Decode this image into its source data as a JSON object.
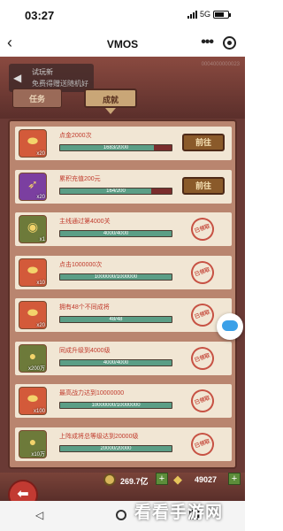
{
  "status": {
    "time": "03:27",
    "network": "5G"
  },
  "nav": {
    "title": "VMOS"
  },
  "game": {
    "ad_line1": "试玩新",
    "ad_line2": "免费得赠送随机好礼",
    "corner_text": "0004000000023",
    "tabs": [
      {
        "label": "任务"
      },
      {
        "label": "成就"
      }
    ],
    "active_tab": "成就",
    "go_label": "前往",
    "claimed_label": "已领取",
    "achievements": [
      {
        "title": "点金2000次",
        "progress_text": "1683/2000",
        "progress": 0.84,
        "reward_count": "x20",
        "icon": "gold-ingot-icon",
        "icon_color": "#d35a3a",
        "action": "go"
      },
      {
        "title": "累积充值200元",
        "progress_text": "164/200",
        "progress": 0.82,
        "reward_count": "x20",
        "icon": "feather-icon",
        "icon_color": "#7b3fa0",
        "action": "go"
      },
      {
        "title": "主线通过第4000关",
        "progress_text": "4000/4000",
        "progress": 1.0,
        "reward_count": "x1",
        "icon": "drum-icon",
        "icon_color": "#6d7a3a",
        "action": "claimed"
      },
      {
        "title": "点击1000000次",
        "progress_text": "1000000/1000000",
        "progress": 1.0,
        "reward_count": "x10",
        "icon": "gold-ingot-icon",
        "icon_color": "#d35a3a",
        "action": "claimed"
      },
      {
        "title": "拥有48个不同成将",
        "progress_text": "48/48",
        "progress": 1.0,
        "reward_count": "x20",
        "icon": "gold-ingot-icon",
        "icon_color": "#d35a3a",
        "action": "claimed"
      },
      {
        "title": "同成升级到4000级",
        "progress_text": "4000/4000",
        "progress": 1.0,
        "reward_count": "x200万",
        "icon": "coin-pile-icon",
        "icon_color": "#6d7a3a",
        "action": "claimed"
      },
      {
        "title": "最高战力达到10000000",
        "progress_text": "10000000/10000000",
        "progress": 1.0,
        "reward_count": "x100",
        "icon": "gold-ingot-icon",
        "icon_color": "#d35a3a",
        "action": "claimed"
      },
      {
        "title": "上阵成将总等级达到20000级",
        "progress_text": "20000/20000",
        "progress": 1.0,
        "reward_count": "x10万",
        "icon": "coin-pile-icon",
        "icon_color": "#6d7a3a",
        "action": "claimed"
      }
    ],
    "currency": {
      "coins": "269.7亿",
      "gems": "49027"
    }
  },
  "watermark": "看看手游网",
  "colors": {
    "go_button": "#8a5a2a",
    "stamp": "#c0392b",
    "progress_fill": "#5b9e86",
    "progress_empty": "#7a2d2d"
  }
}
